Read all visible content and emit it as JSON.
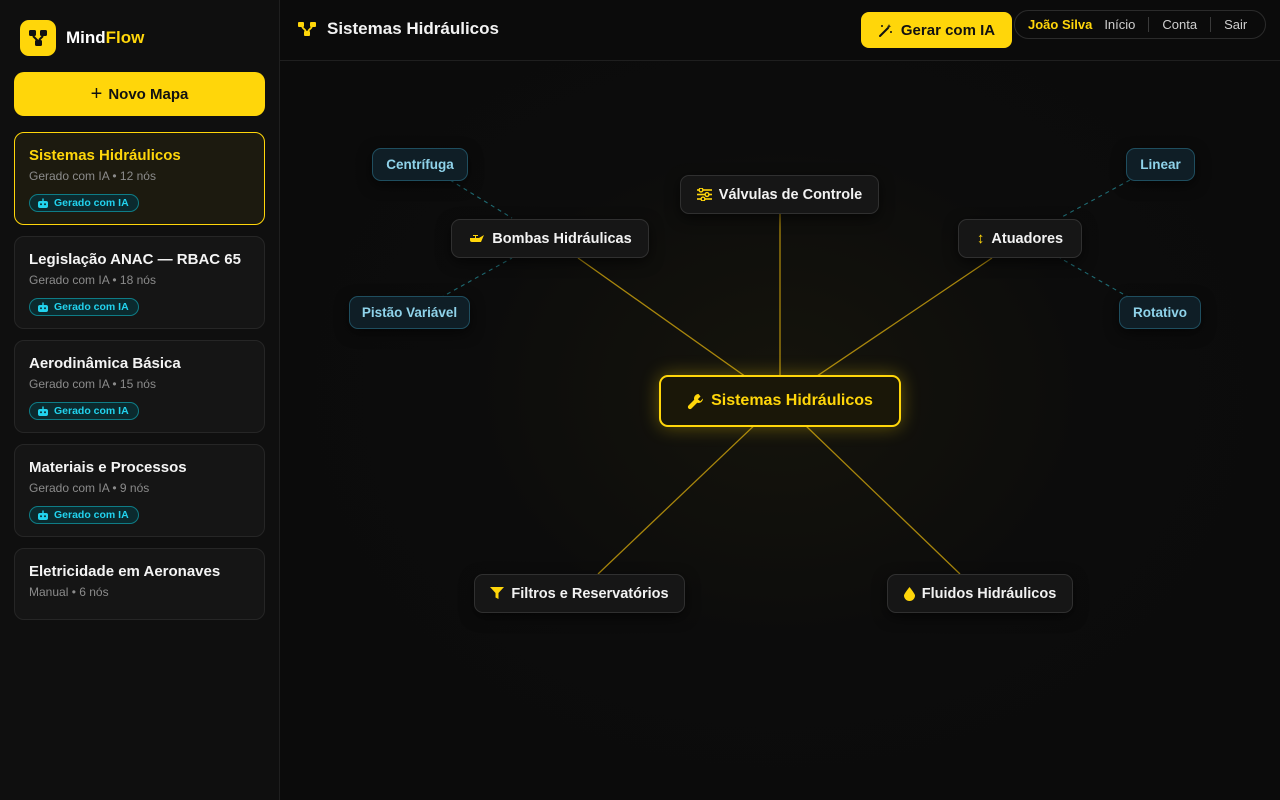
{
  "app": {
    "name_part1": "Mind",
    "name_part2": "Flow",
    "accent_color": "#ffd60a",
    "ai_color": "#22d3ee"
  },
  "sidebar": {
    "new_map_label": "Novo Mapa",
    "maps": [
      {
        "title": "Sistemas Hidráulicos",
        "meta": "Gerado com IA • 12 nós",
        "badge": "Gerado com IA",
        "active": true
      },
      {
        "title": "Legislação ANAC — RBAC 65",
        "meta": "Gerado com IA • 18 nós",
        "badge": "Gerado com IA",
        "active": false
      },
      {
        "title": "Aerodinâmica Básica",
        "meta": "Gerado com IA • 15 nós",
        "badge": "Gerado com IA",
        "active": false
      },
      {
        "title": "Materiais e Processos",
        "meta": "Gerado com IA • 9 nós",
        "badge": "Gerado com IA",
        "active": false
      },
      {
        "title": "Eletricidade em Aeronaves",
        "meta": "Manual • 6 nós",
        "badge": null,
        "active": false
      }
    ]
  },
  "header": {
    "title": "Sistemas Hidráulicos",
    "generate_label": "Gerar com IA",
    "user_name": "João Silva",
    "nav": [
      "Início",
      "Conta",
      "Sair"
    ]
  },
  "mindmap": {
    "center": {
      "label": "Sistemas Hidráulicos",
      "icon": "wrench-icon"
    },
    "branches": [
      {
        "label": "Válvulas de Controle",
        "icon": "sliders-icon"
      },
      {
        "label": "Bombas Hidráulicas",
        "icon": "oil-can-icon"
      },
      {
        "label": "Atuadores",
        "icon": "arrows-vertical-icon"
      },
      {
        "label": "Filtros e Reservatórios",
        "icon": "filter-icon"
      },
      {
        "label": "Fluidos Hidráulicos",
        "icon": "droplet-icon"
      }
    ],
    "leaves": [
      {
        "label": "Centrífuga",
        "parent": "Bombas Hidráulicas"
      },
      {
        "label": "Pistão Variável",
        "parent": "Bombas Hidráulicas"
      },
      {
        "label": "Linear",
        "parent": "Atuadores"
      },
      {
        "label": "Rotativo",
        "parent": "Atuadores"
      }
    ]
  }
}
